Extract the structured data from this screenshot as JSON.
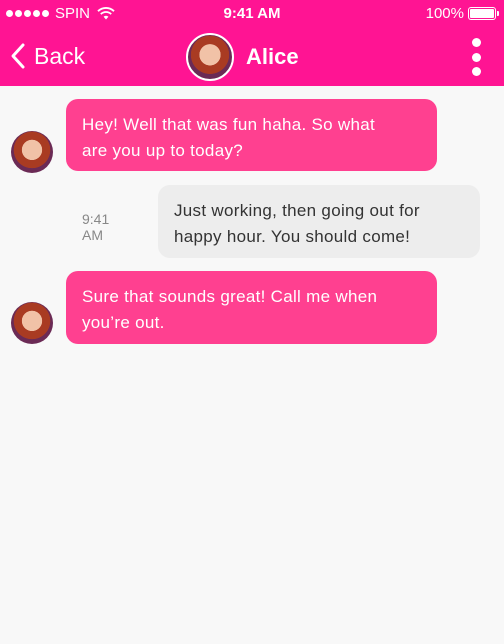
{
  "status_bar": {
    "carrier": "SPIN",
    "time": "9:41 AM",
    "battery": "100%",
    "signal_strength": 5,
    "icons": [
      "signal-dots-icon",
      "wifi-icon",
      "battery-icon"
    ]
  },
  "nav": {
    "back_label": "Back",
    "contact_name": "Alice",
    "icons": [
      "chevron-left-icon",
      "more-vertical-icon"
    ]
  },
  "colors": {
    "header": "#ff1493",
    "incoming_bubble": "#ff4090",
    "outgoing_bubble": "#ededed",
    "background": "#f8f8f8"
  },
  "messages": [
    {
      "sender": "Alice",
      "direction": "incoming",
      "lines": [
        "Hey! Well that was fun haha. So what",
        "are you up to today?"
      ]
    },
    {
      "sender": "me",
      "direction": "outgoing",
      "timestamp": "9:41 AM",
      "lines": [
        "Just working, then going out for",
        "happy hour. You should come!"
      ]
    },
    {
      "sender": "Alice",
      "direction": "incoming",
      "lines": [
        "Sure that sounds great! Call me when",
        "you’re out."
      ]
    }
  ]
}
